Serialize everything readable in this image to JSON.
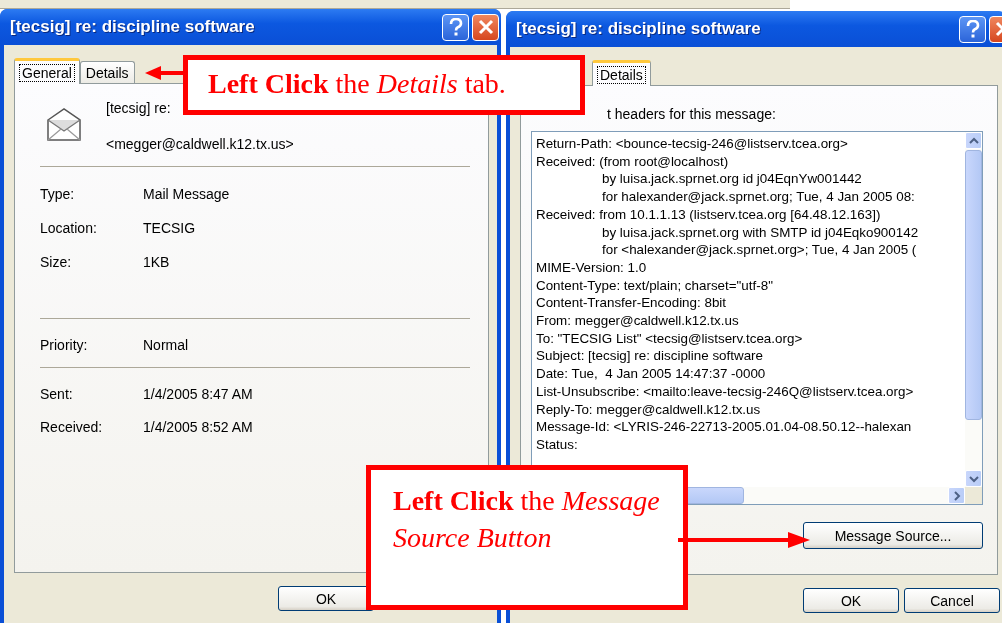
{
  "left_dialog": {
    "title": "[tecsig] re: discipline software",
    "tabs": [
      {
        "label": "General",
        "selected": true
      },
      {
        "label": "Details",
        "selected": false
      }
    ],
    "subject": "[tecsig] re:",
    "sender": "<megger@caldwell.k12.tx.us>",
    "field_groups": [
      [
        {
          "label": "Type:",
          "value": "Mail Message"
        },
        {
          "label": "Location:",
          "value": "TECSIG"
        },
        {
          "label": "Size:",
          "value": "1KB"
        }
      ],
      [
        {
          "label": "Priority:",
          "value": "Normal"
        }
      ],
      [
        {
          "label": "Sent:",
          "value": "1/4/2005 8:47 AM"
        },
        {
          "label": "Received:",
          "value": "1/4/2005 8:52 AM"
        }
      ]
    ],
    "buttons": [
      "OK"
    ]
  },
  "right_dialog": {
    "title": "[tecsig] re: discipline software",
    "tabs": [
      {
        "label": "Details",
        "selected": true
      }
    ],
    "intro": "t headers for this message:",
    "header_lines": [
      {
        "text": "Return-Path: <bounce-tecsig-246@listserv.tcea.org>",
        "continued": false
      },
      {
        "text": "Received: (from root@localhost)",
        "continued": false
      },
      {
        "text": "by luisa.jack.sprnet.org id j04EqnYw001442",
        "continued": true
      },
      {
        "text": "for halexander@jack.sprnet.org; Tue, 4 Jan 2005 08:",
        "continued": true
      },
      {
        "text": "Received: from 10.1.1.13 (listserv.tcea.org [64.48.12.163])",
        "continued": false
      },
      {
        "text": "by luisa.jack.sprnet.org with SMTP id j04Eqko900142",
        "continued": true
      },
      {
        "text": "for <halexander@jack.sprnet.org>; Tue, 4 Jan 2005 (",
        "continued": true
      },
      {
        "text": "MIME-Version: 1.0",
        "continued": false
      },
      {
        "text": "Content-Type: text/plain; charset=\"utf-8\"",
        "continued": false
      },
      {
        "text": "Content-Transfer-Encoding: 8bit",
        "continued": false
      },
      {
        "text": "From: megger@caldwell.k12.tx.us",
        "continued": false
      },
      {
        "text": "To: \"TECSIG List\" <tecsig@listserv.tcea.org>",
        "continued": false
      },
      {
        "text": "Subject: [tecsig] re: discipline software",
        "continued": false
      },
      {
        "text": "Date: Tue,  4 Jan 2005 14:47:37 -0000",
        "continued": false
      },
      {
        "text": "List-Unsubscribe: <mailto:leave-tecsig-246Q@listserv.tcea.org>",
        "continued": false
      },
      {
        "text": "Reply-To: megger@caldwell.k12.tx.us",
        "continued": false
      },
      {
        "text": "Message-Id: <LYRIS-246-22713-2005.01.04-08.50.12--halexan",
        "continued": false
      },
      {
        "text": "Status:",
        "continued": false
      }
    ],
    "source_button": "Message Source...",
    "buttons": [
      "OK",
      "Cancel"
    ]
  },
  "callouts": [
    {
      "text": "**Left Click** the *Details* tab."
    },
    {
      "text": "**Left Click** the *Message Source Button*"
    }
  ]
}
